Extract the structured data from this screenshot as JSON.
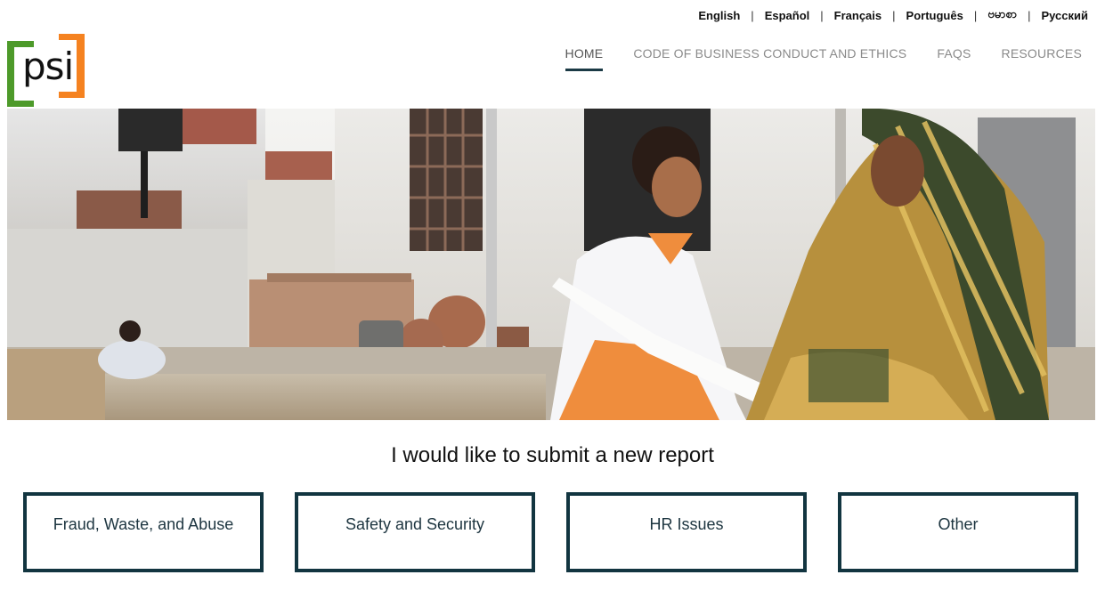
{
  "languages": [
    "English",
    "Español",
    "Français",
    "Português",
    "ဗမာစာ",
    "Русский"
  ],
  "logo": {
    "text": "psi",
    "colors": {
      "green": "#4d9a2a",
      "orange": "#f58220"
    }
  },
  "nav": {
    "items": [
      {
        "label": "HOME",
        "active": true
      },
      {
        "label": "CODE OF BUSINESS CONDUCT AND ETHICS",
        "active": false
      },
      {
        "label": "FAQS",
        "active": false
      },
      {
        "label": "RESOURCES",
        "active": false
      }
    ]
  },
  "report": {
    "heading": "I would like to submit a new report",
    "options": [
      "Fraud, Waste, and Abuse",
      "Safety and Security",
      "HR Issues",
      "Other"
    ]
  },
  "colors": {
    "accent": "#123540",
    "nav_text": "#8a8a8a"
  }
}
